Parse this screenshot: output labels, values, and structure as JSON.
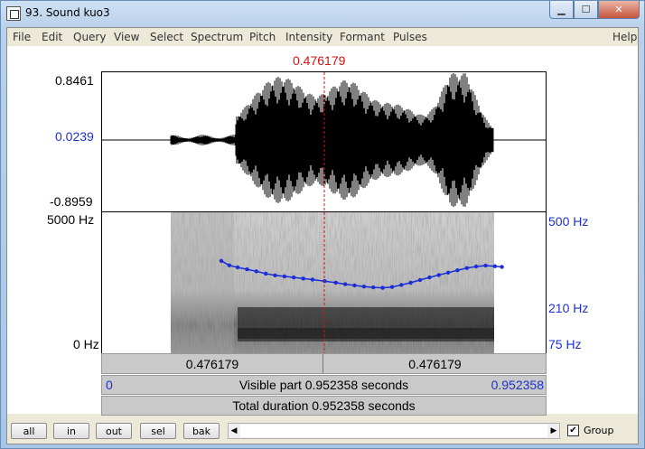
{
  "window": {
    "title": "93. Sound kuo3",
    "min": "▁",
    "max": "☐",
    "close": "✕"
  },
  "menu": [
    "File",
    "Edit",
    "Query",
    "View",
    "Select",
    "Spectrum",
    "Pitch",
    "Intensity",
    "Formant",
    "Pulses",
    "Help"
  ],
  "cursor": {
    "time": "0.476179"
  },
  "waveform": {
    "max": "0.8461",
    "mid": "0.0239",
    "min": "-0.8959"
  },
  "spectrogram": {
    "freq_top": "5000 Hz",
    "freq_bottom": "0 Hz"
  },
  "pitch_axis": {
    "top": "500 Hz",
    "mid": "210 Hz",
    "bottom": "75 Hz"
  },
  "pitch_track": {
    "unit": "Hz",
    "points": [
      {
        "t": 0.255,
        "f": 260
      },
      {
        "t": 0.272,
        "f": 245
      },
      {
        "t": 0.29,
        "f": 238
      },
      {
        "t": 0.31,
        "f": 232
      },
      {
        "t": 0.33,
        "f": 226
      },
      {
        "t": 0.35,
        "f": 219
      },
      {
        "t": 0.37,
        "f": 214
      },
      {
        "t": 0.39,
        "f": 211
      },
      {
        "t": 0.41,
        "f": 208
      },
      {
        "t": 0.43,
        "f": 205
      },
      {
        "t": 0.45,
        "f": 202
      },
      {
        "t": 0.476,
        "f": 198
      },
      {
        "t": 0.5,
        "f": 194
      },
      {
        "t": 0.52,
        "f": 190
      },
      {
        "t": 0.54,
        "f": 187
      },
      {
        "t": 0.56,
        "f": 184
      },
      {
        "t": 0.58,
        "f": 182
      },
      {
        "t": 0.6,
        "f": 181
      },
      {
        "t": 0.62,
        "f": 183
      },
      {
        "t": 0.64,
        "f": 188
      },
      {
        "t": 0.66,
        "f": 194
      },
      {
        "t": 0.68,
        "f": 201
      },
      {
        "t": 0.7,
        "f": 208
      },
      {
        "t": 0.72,
        "f": 215
      },
      {
        "t": 0.74,
        "f": 222
      },
      {
        "t": 0.76,
        "f": 229
      },
      {
        "t": 0.78,
        "f": 236
      },
      {
        "t": 0.8,
        "f": 241
      },
      {
        "t": 0.82,
        "f": 244
      },
      {
        "t": 0.84,
        "f": 242
      },
      {
        "t": 0.855,
        "f": 240
      }
    ]
  },
  "time_bar": {
    "left": "0.476179",
    "right": "0.476179"
  },
  "visible_bar": {
    "start": "0",
    "text": "Visible part 0.952358 seconds",
    "end": "0.952358"
  },
  "total_bar": {
    "text": "Total duration 0.952358 seconds"
  },
  "toolbar": {
    "all": "all",
    "in": "in",
    "out": "out",
    "sel": "sel",
    "bak": "bak",
    "group": "Group",
    "group_checked": "✔"
  },
  "colors": {
    "cursor": "#d21414",
    "pitch": "#1a2dd6",
    "axis_blue": "#1f32c8"
  }
}
